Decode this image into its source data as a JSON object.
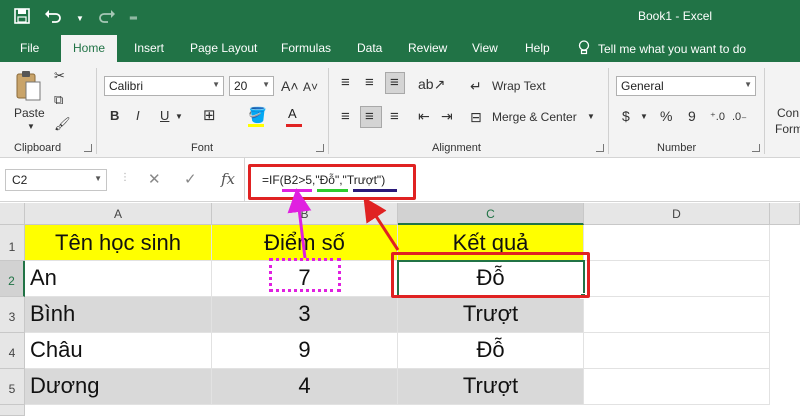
{
  "window": {
    "title": "Book1  -  Excel"
  },
  "qat": {
    "save_icon": "save-icon",
    "undo_icon": "undo-icon",
    "redo_icon": "redo-icon",
    "customize_icon": "customize-icon"
  },
  "tabs": [
    {
      "label": "File"
    },
    {
      "label": "Home"
    },
    {
      "label": "Insert"
    },
    {
      "label": "Page Layout"
    },
    {
      "label": "Formulas"
    },
    {
      "label": "Data"
    },
    {
      "label": "Review"
    },
    {
      "label": "View"
    },
    {
      "label": "Help"
    }
  ],
  "tell_me": "Tell me what you want to do",
  "ribbon": {
    "clipboard": {
      "label": "Clipboard",
      "paste": "Paste"
    },
    "font": {
      "label": "Font",
      "name": "Calibri",
      "size": "20",
      "bold": "B",
      "italic": "I",
      "underline": "U",
      "font_color_letter": "A"
    },
    "alignment": {
      "label": "Alignment",
      "wrap_text": "Wrap Text",
      "merge_center": "Merge & Center"
    },
    "number": {
      "label": "Number",
      "format": "General",
      "currency": "$",
      "percent": "%",
      "comma": "9"
    },
    "styles": {
      "cond_label_1": "Con",
      "cond_label_2": "Form"
    }
  },
  "formula_bar": {
    "name_box": "C2",
    "cancel": "✕",
    "enter": "✓",
    "fx": "fx",
    "formula": "=IF(B2>5,\"Đỗ\",\"Trượt\")"
  },
  "columns": [
    "A",
    "B",
    "C",
    "D"
  ],
  "rows": [
    "1",
    "2",
    "3",
    "4",
    "5"
  ],
  "table": {
    "header": [
      "Tên học sinh",
      "Điểm số",
      "Kết quả"
    ],
    "data": [
      [
        "An",
        "7",
        "Đỗ"
      ],
      [
        "Bình",
        "3",
        "Trượt"
      ],
      [
        "Châu",
        "9",
        "Đỗ"
      ],
      [
        "Dương",
        "4",
        "Trượt"
      ]
    ]
  },
  "colors": {
    "excel_green": "#217346",
    "highlight_yellow": "#ffff00",
    "row_grey": "#d9d9d9",
    "annotation_red": "#e02222",
    "annotation_magenta": "#e020e0",
    "annotation_green": "#2ecc2e",
    "annotation_navy": "#2a1a7a"
  }
}
